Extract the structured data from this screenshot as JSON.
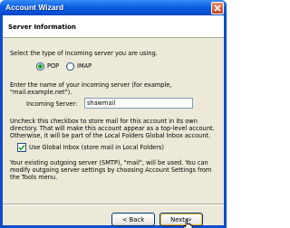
{
  "window": {
    "title": "Account Wizard"
  },
  "header": {
    "title": "Server Information"
  },
  "server_type": {
    "prompt": "Select the type of incoming server you are using.",
    "options": [
      {
        "label": "POP",
        "selected": true
      },
      {
        "label": "IMAP",
        "selected": false
      }
    ]
  },
  "incoming_server": {
    "prompt_line1": "Enter the name of your incoming server (for example,",
    "prompt_line2": "\"mail.example.net\").",
    "label": "Incoming Server:",
    "value": "shawmail"
  },
  "global_inbox": {
    "desc_line1": "Uncheck this checkbox to store mail for this account in its own",
    "desc_line2": "directory. That will make this account appear as a top-level account.",
    "desc_line3": "Otherwise, it will be part of the Local Folders Global Inbox account.",
    "checkbox_label": "Use Global Inbox (store mail in Local Folders)",
    "checked": true
  },
  "outgoing_note": {
    "line1": "Your existing outgoing server (SMTP), \"mail\", will be used. You can",
    "line2": "modify outgoing server settings by choosing Account Settings from",
    "line3": "the Tools menu."
  },
  "buttons": {
    "back": "< Back",
    "next": "Next >"
  },
  "colors": {
    "titlebar": "#0d5fe0",
    "dialog_bg": "#ece9d8",
    "radio_dot": "#21a121"
  }
}
